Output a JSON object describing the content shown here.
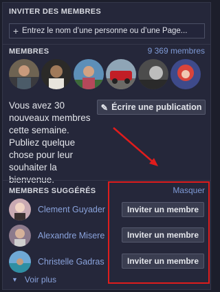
{
  "invite": {
    "title": "INVITER DES MEMBRES",
    "placeholder": "Entrez le nom d’une personne ou d’une Page..."
  },
  "members": {
    "title": "MEMBRES",
    "count": "9 369 membres",
    "new_text": "Vous avez 30 nouveaux membres cette semaine. Publiez quelque chose pour leur souhaiter la bienvenue.",
    "write_button": "Écrire une publication"
  },
  "suggested": {
    "title": "MEMBRES SUGGÉRÉS",
    "hide": "Masquer",
    "people": [
      {
        "name": "Clement Guyader",
        "button": "Inviter un membre"
      },
      {
        "name": "Alexandre Misere",
        "button": "Inviter un membre"
      },
      {
        "name": "Christelle Gadras",
        "button": "Inviter un membre"
      }
    ],
    "see_more": "Voir plus"
  },
  "colors": {
    "accent_link": "#7f9ad6",
    "highlight_red": "#e01c1c",
    "background": "#25273a"
  },
  "icons": [
    "plus-icon",
    "pencil-icon",
    "chevron-down-icon",
    "red-arrow"
  ]
}
